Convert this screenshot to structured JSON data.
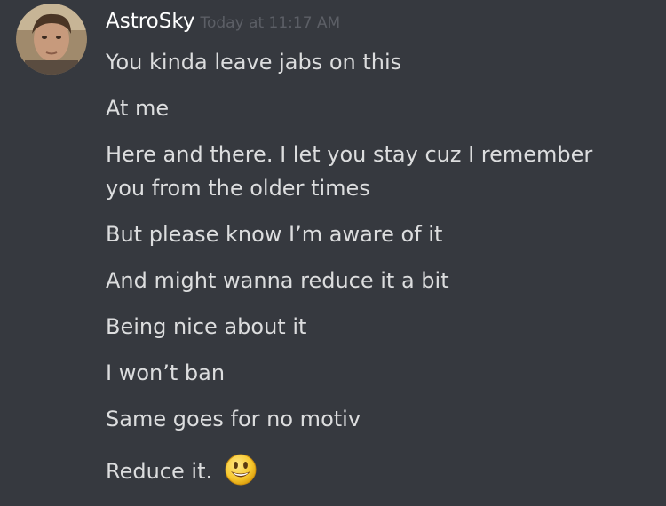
{
  "author": {
    "username": "AstroSky",
    "timestamp": "Today at 11:17 AM",
    "avatar_icon": "user-avatar-photo"
  },
  "colors": {
    "background": "#36393f",
    "username": "#ffffff",
    "timestamp": "#5c5f66",
    "message_text": "#dcddde"
  },
  "messages": [
    {
      "text": "You kinda leave jabs on this"
    },
    {
      "text": "At me"
    },
    {
      "text": "Here and there. I let you stay cuz I remember"
    },
    {
      "text": "you from the older times"
    },
    {
      "text": "But please know I’m aware of it"
    },
    {
      "text": "And might wanna reduce it a bit"
    },
    {
      "text": "Being nice about it"
    },
    {
      "text": "I won’t ban"
    },
    {
      "text": "Same goes for no motiv"
    },
    {
      "text": "Reduce it.",
      "emoji": "smiley-emoji"
    }
  ]
}
